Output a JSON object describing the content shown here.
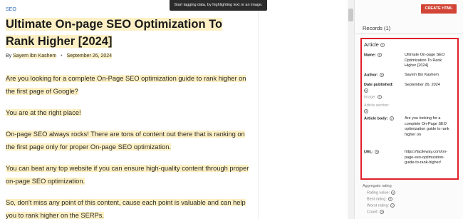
{
  "toast": {
    "text": "Start tagging data, by highlighting text or an image."
  },
  "article": {
    "category": "SEO",
    "title": "Ultimate On-page SEO Optimization To Rank Higher [2024]",
    "meta": {
      "by_label": "By",
      "author": "Sayem Ibn Kashem",
      "bullet": "•",
      "date": "September 26, 2024"
    },
    "paragraphs": [
      "Are you looking for a complete On-Page SEO optimization guide to rank higher on the first page of Google?",
      "You are at the right place!",
      "On-page SEO always rocks! There are tons of content out there that is ranking on the first page only for proper On-page SEO optimization.",
      "You can beat any top website if you can ensure high-quality content through proper on-page SEO optimization.",
      "So, don't miss any point of this content, cause each point is valuable and can help you to rank higher on the SERPs."
    ]
  },
  "tool": {
    "create_button": "CREATE HTML",
    "records_label": "Records (1)",
    "item_type": "Article",
    "help_icon": "question-circle-icon",
    "properties": {
      "name": {
        "label": "Name:",
        "value": "Ultimate On-page SEO Optimization To Rank Higher [2024]"
      },
      "author": {
        "label": "Author:",
        "value": "Sayem Ibn Kashem"
      },
      "date_published": {
        "label": "Date published:",
        "value": "September 26, 2024"
      },
      "image": {
        "label": "Image:"
      },
      "article_section": {
        "label": "Article section:"
      },
      "article_body": {
        "label": "Article body:",
        "value": "Are you looking for a complete On-Page SEO optimization guide to rank higher on"
      },
      "url": {
        "label": "URL:",
        "value": "https://facileway.com/on-page-seo-optimization-guide-to-rank-higher/"
      }
    },
    "aggregate_rating": {
      "heading": "Aggregate rating",
      "items": [
        "Rating value:",
        "Best rating:",
        "Worst rating:",
        "Count:"
      ]
    }
  },
  "colors": {
    "highlight": "#fdf0c4",
    "accent_red": "#d24536",
    "box_border": "#e0202a",
    "category_link": "#2a6ab7"
  }
}
